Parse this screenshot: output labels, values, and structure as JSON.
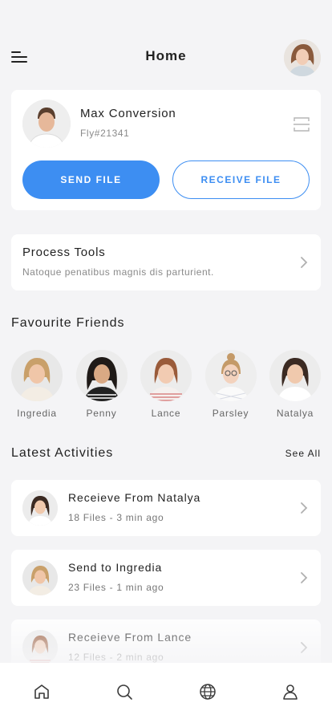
{
  "header": {
    "title": "Home",
    "menu_icon": "menu-icon",
    "avatar": "user-avatar"
  },
  "profile": {
    "name": "Max Conversion",
    "id": "Fly#21341",
    "scan_icon": "scan-icon",
    "send_label": "SEND FILE",
    "receive_label": "RECEIVE FILE"
  },
  "tools": {
    "title": "Process Tools",
    "subtitle": "Natoque penatibus magnis dis parturient.",
    "chevron_icon": "chevron-right-icon"
  },
  "friends": {
    "title": "Favourite Friends",
    "items": [
      {
        "name": "Ingredia"
      },
      {
        "name": "Penny"
      },
      {
        "name": "Lance"
      },
      {
        "name": "Parsley"
      },
      {
        "name": "Natalya"
      }
    ]
  },
  "activities": {
    "title": "Latest Activities",
    "see_all": "See All",
    "items": [
      {
        "title": "Receieve From Natalya",
        "meta": "18 Files - 3 min ago"
      },
      {
        "title": "Send to Ingredia",
        "meta": "23 Files - 1 min ago"
      },
      {
        "title": "Receieve From Lance",
        "meta": "12 Files - 2 min ago"
      }
    ]
  },
  "tabbar": {
    "items": [
      {
        "icon": "home-icon"
      },
      {
        "icon": "search-icon"
      },
      {
        "icon": "globe-icon"
      },
      {
        "icon": "profile-icon"
      }
    ]
  },
  "colors": {
    "accent": "#3d8ef2",
    "background": "#f4f4f6",
    "card": "#ffffff"
  }
}
